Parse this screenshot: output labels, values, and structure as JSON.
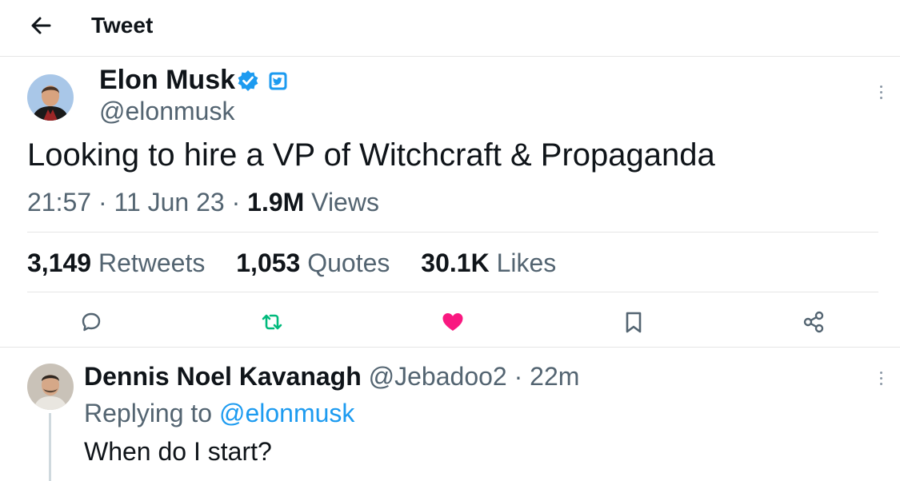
{
  "header": {
    "title": "Tweet"
  },
  "tweet": {
    "author": {
      "name": "Elon Musk",
      "handle": "@elonmusk"
    },
    "text": "Looking to hire a VP of Witchcraft & Propaganda",
    "time": "21:57",
    "sep1": "·",
    "date": "11 Jun 23",
    "sep2": "·",
    "views_count": "1.9M",
    "views_label": "Views",
    "stats": {
      "retweets_count": "3,149",
      "retweets_label": "Retweets",
      "quotes_count": "1,053",
      "quotes_label": "Quotes",
      "likes_count": "30.1K",
      "likes_label": "Likes"
    },
    "actions": {
      "reply_icon": "speech-bubble-icon",
      "retweet_icon": "retweet-arrows-icon",
      "like_icon": "heart-icon",
      "bookmark_icon": "bookmark-icon",
      "share_icon": "share-nodes-icon"
    },
    "colors": {
      "retweet": "#00ba7c",
      "like": "#f91880",
      "verified": "#1d9bf0"
    }
  },
  "reply": {
    "name": "Dennis Noel Kavanagh",
    "handle": "@Jebadoo2",
    "sep": "·",
    "time": "22m",
    "replying_prefix": "Replying to",
    "replying_handle": "@elonmusk",
    "text": "When do I start?"
  }
}
